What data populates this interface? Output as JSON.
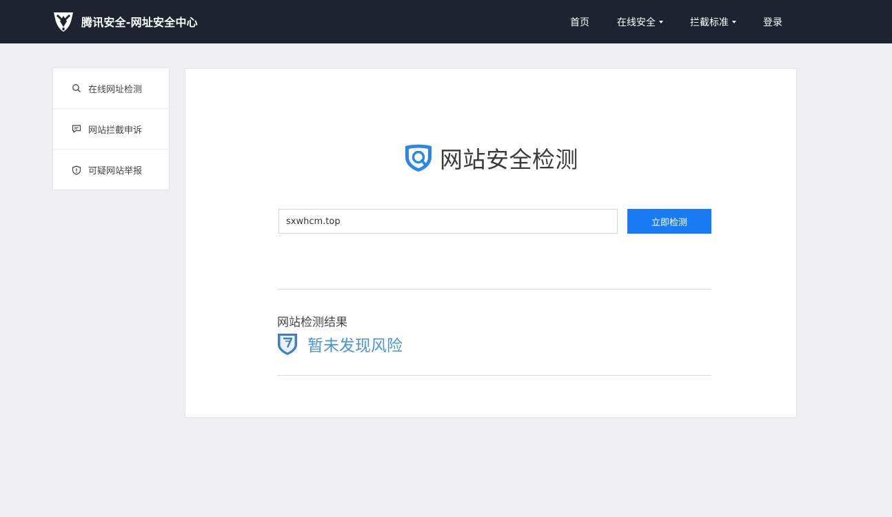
{
  "header": {
    "brand_title": "腾讯安全-网址安全中心",
    "nav": {
      "home": "首页",
      "online_security": "在线安全",
      "block_standard": "拦截标准",
      "login": "登录"
    }
  },
  "sidebar": {
    "items": [
      {
        "label": "在线网址检测",
        "icon": "search-icon"
      },
      {
        "label": "网站拦截申诉",
        "icon": "chat-bubble-icon"
      },
      {
        "label": "可疑网站举报",
        "icon": "shield-alert-icon"
      }
    ]
  },
  "main": {
    "title": "网站安全检测",
    "search": {
      "value": "sxwhcm.top",
      "button_label": "立即检测"
    },
    "result": {
      "label": "网站检测结果",
      "value": "暂未发现风险"
    }
  },
  "colors": {
    "header_bg": "#1f2230",
    "page_bg": "#efeff3",
    "primary_button": "#1a7cf3",
    "result_text": "#4a94d6"
  }
}
